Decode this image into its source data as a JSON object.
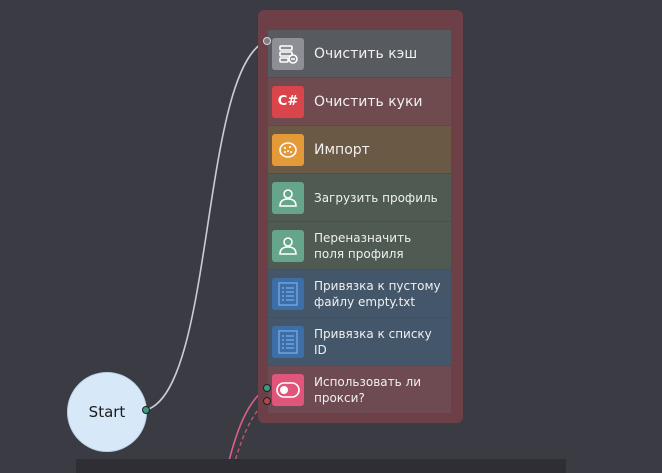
{
  "start": {
    "label": "Start"
  },
  "items": [
    {
      "label": "Очистить кэш",
      "icon": "cache-clear-icon",
      "bg": "#575a5f",
      "icon_bg": "#8d8f94"
    },
    {
      "label": "Очистить куки",
      "icon": "csharp-icon",
      "icon_text": "C#",
      "bg": "#6f4a4f",
      "icon_bg": "#d9454a"
    },
    {
      "label": "Импорт",
      "icon": "cookie-icon",
      "bg": "#6a5a45",
      "icon_bg": "#e59a3a"
    },
    {
      "label": "Загрузить профиль",
      "icon": "user-icon",
      "bg": "#4f5a52",
      "icon_bg": "#66a58a"
    },
    {
      "label": "Переназначить\nполя профиля",
      "icon": "user-icon",
      "bg": "#4f5a52",
      "icon_bg": "#66a58a"
    },
    {
      "label": "Привязка к пустому\nфайлу empty.txt",
      "icon": "list-icon",
      "bg": "#44566a",
      "icon_bg": "#3f6ea6"
    },
    {
      "label": "Привязка к списку\nID",
      "icon": "list-icon",
      "bg": "#44566a",
      "icon_bg": "#3f6ea6"
    },
    {
      "label": "Использовать ли\nпрокси?",
      "icon": "toggle-icon",
      "bg": "#6e4a53",
      "icon_bg": "#e0557a"
    }
  ]
}
